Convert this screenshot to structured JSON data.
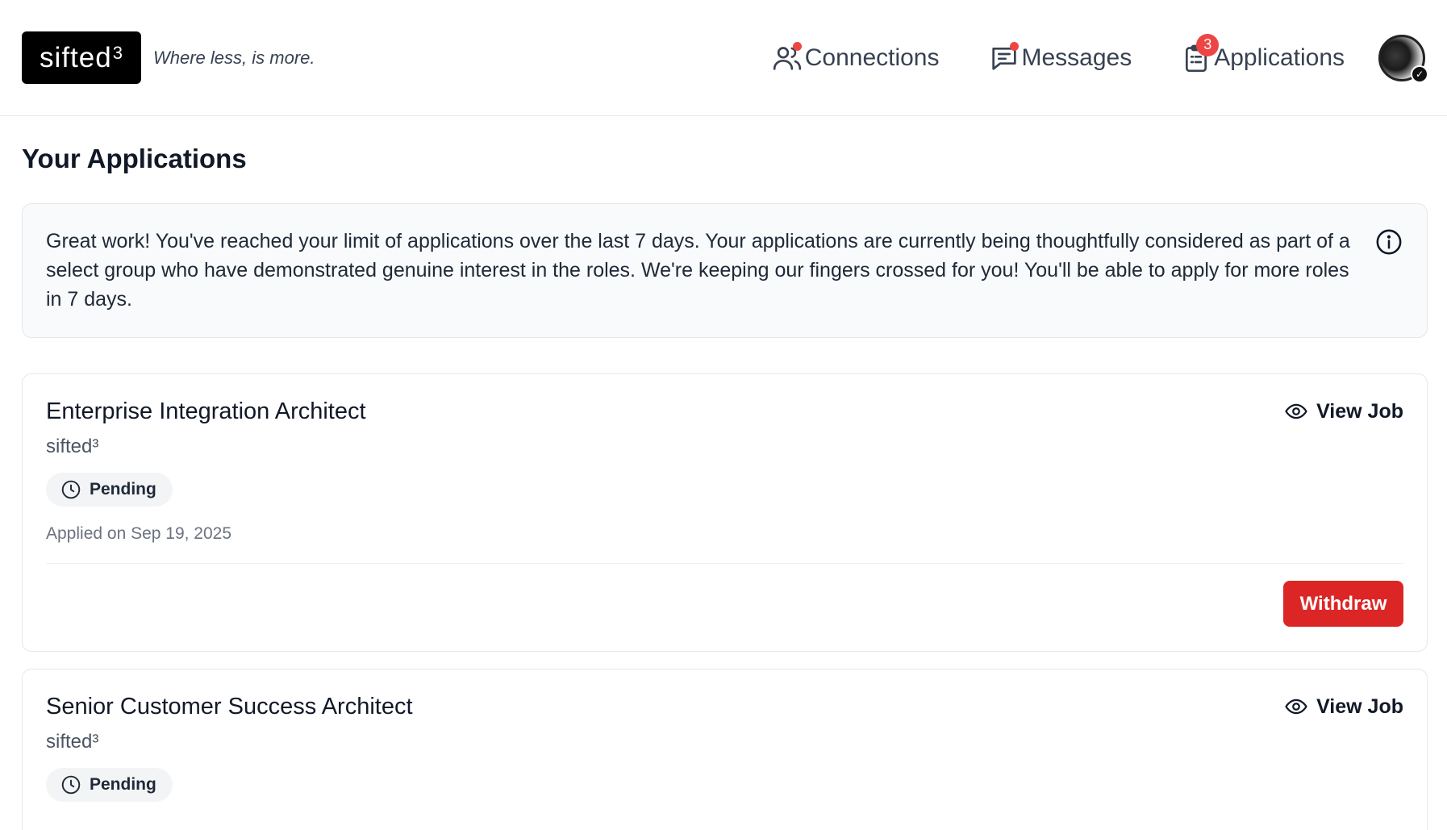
{
  "header": {
    "logo_text": "sifted",
    "logo_sup": "3",
    "tagline": "Where less, is more.",
    "nav": [
      {
        "label": "Connections",
        "icon": "users-icon",
        "indicator": "dot"
      },
      {
        "label": "Messages",
        "icon": "message-icon",
        "indicator": "dot"
      },
      {
        "label": "Applications",
        "icon": "clipboard-icon",
        "badge": "3"
      }
    ],
    "avatar_check": "✓"
  },
  "page_title": "Your Applications",
  "notice": {
    "text": "Great work! You've reached your limit of applications over the last 7 days. Your applications are currently being thoughtfully considered as part of a select group who have demonstrated genuine interest in the roles. We're keeping our fingers crossed for you! You'll be able to apply for more roles in 7 days.",
    "icon": "info-icon"
  },
  "applications": [
    {
      "title": "Enterprise Integration Architect",
      "company": "sifted³",
      "status": "Pending",
      "applied": "Applied on Sep 19, 2025",
      "view_label": "View Job",
      "withdraw_label": "Withdraw"
    },
    {
      "title": "Senior Customer Success Architect",
      "company": "sifted³",
      "status": "Pending",
      "view_label": "View Job"
    }
  ],
  "colors": {
    "accent_red": "#dc2626",
    "badge_red": "#ef4444",
    "notice_bg": "#f8fafc"
  }
}
